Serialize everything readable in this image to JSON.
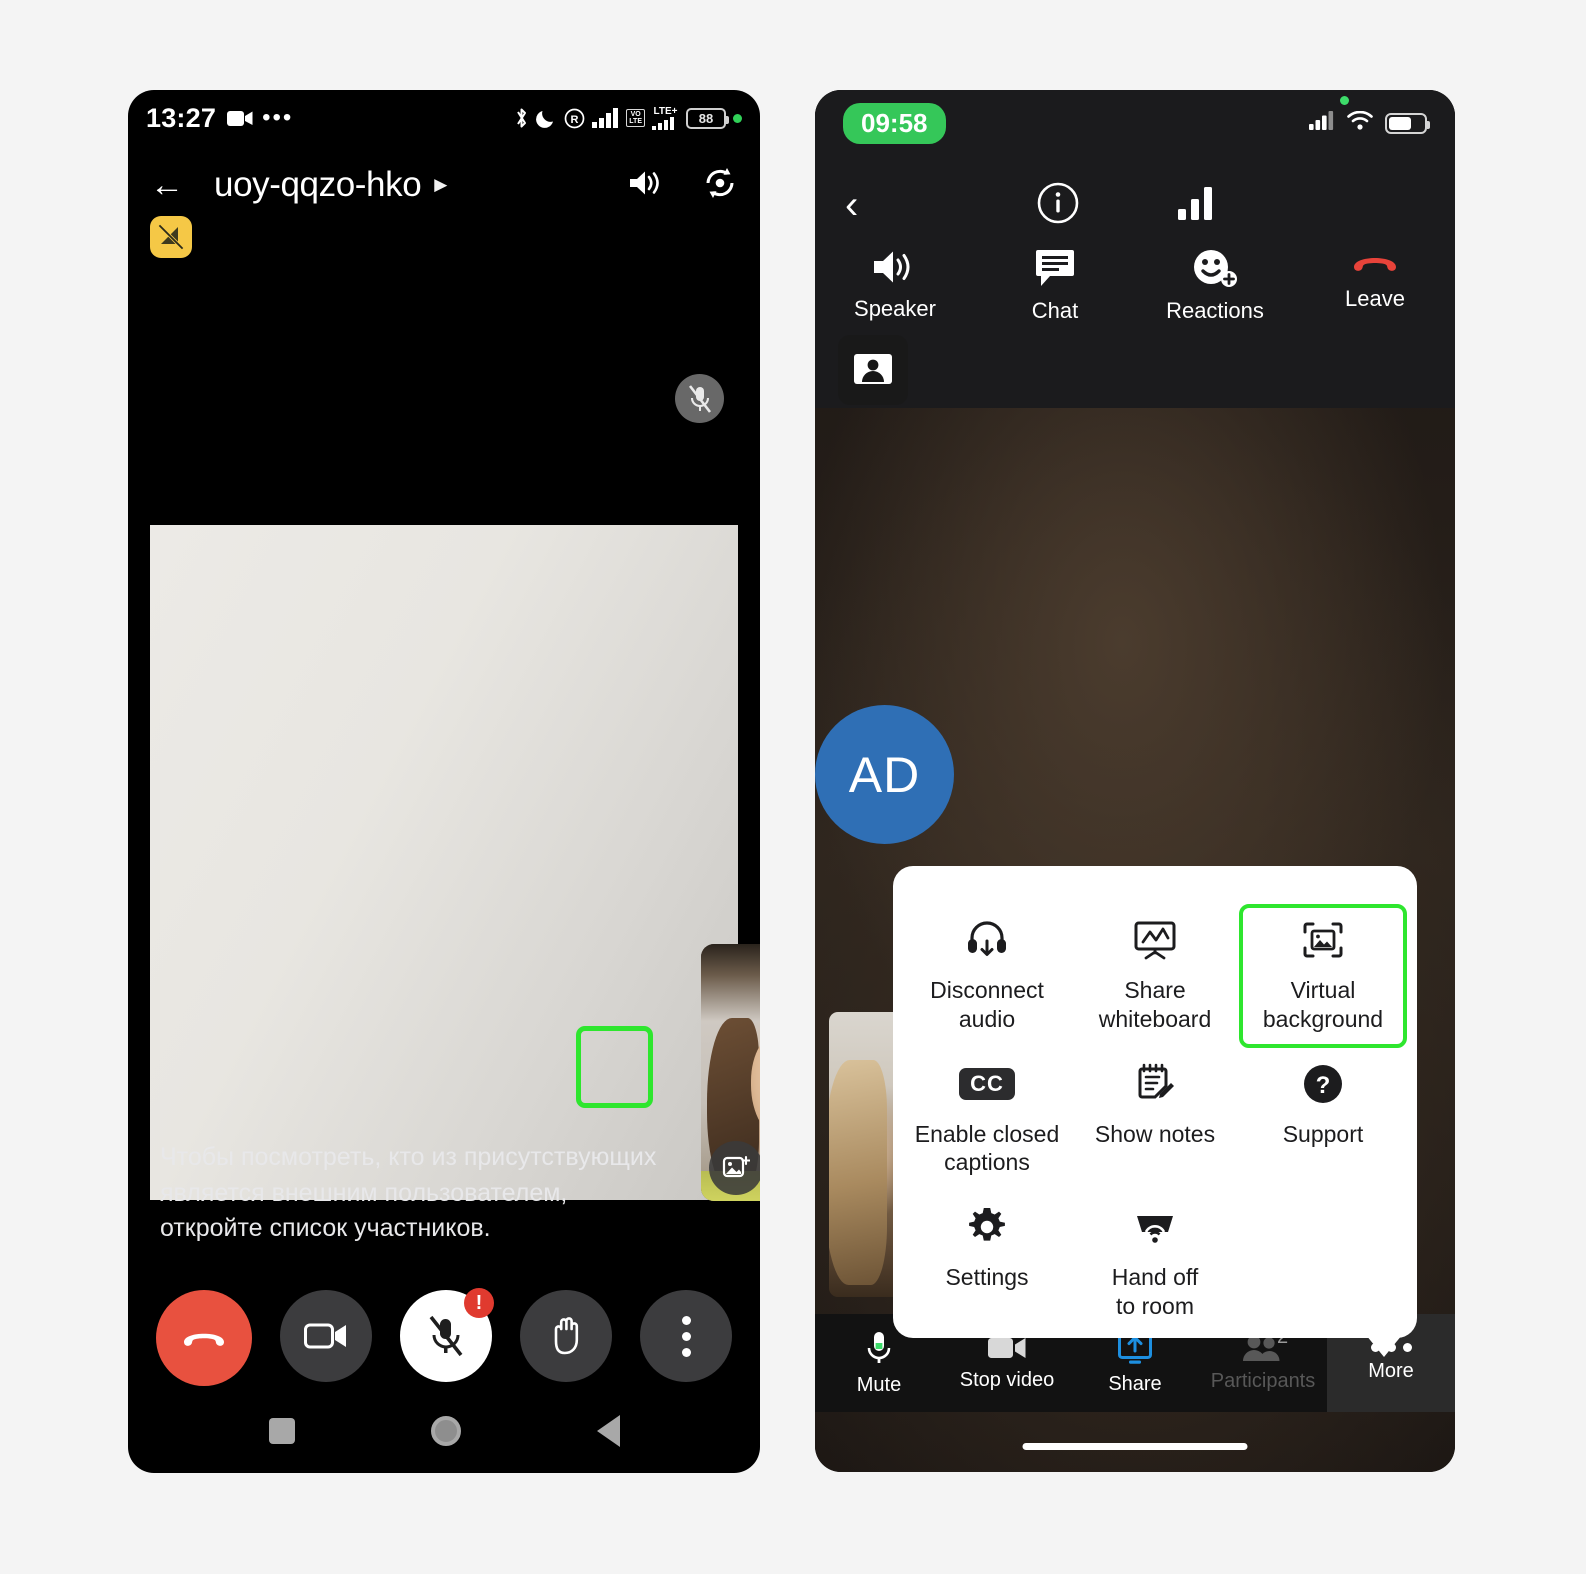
{
  "android": {
    "status_bar": {
      "time": "13:27",
      "battery_level": "88",
      "icons": [
        "camera-icon",
        "more-dots-icon",
        "bluetooth-icon",
        "dnd-moon-icon",
        "roaming-r-icon",
        "signal-bars-icon",
        "volte-icon",
        "lte-plus-icon",
        "battery-icon",
        "green-dot-icon"
      ],
      "volte_label": "VO\nLTE",
      "lte_label": "LTE+"
    },
    "header": {
      "meeting_code": "uoy-qqzo-hko",
      "back_icon": "back-arrow-icon",
      "caret_icon": "chevron-right-icon",
      "speaker_icon": "speaker-icon",
      "flip_camera_icon": "flip-camera-icon"
    },
    "network_badge_icon": "network-off-icon",
    "stage": {
      "mic_muted_icon": "mic-off-icon"
    },
    "pip": {
      "effects_icon": "image-effects-icon",
      "more_icon": "more-vertical-icon",
      "highlighted": "effects-button"
    },
    "caption": "Чтобы посмотреть, кто из присутствующих является внешним пользователем, откройте список участников.",
    "controls": [
      {
        "name": "end-call-button",
        "icon": "phone-hangup-icon",
        "style": "end"
      },
      {
        "name": "camera-button",
        "icon": "video-camera-icon",
        "style": "dark"
      },
      {
        "name": "mic-button",
        "icon": "mic-off-icon",
        "style": "white",
        "badge": "!"
      },
      {
        "name": "raise-hand-button",
        "icon": "raised-hand-icon",
        "style": "dark"
      },
      {
        "name": "more-button",
        "icon": "more-vertical-icon",
        "style": "dark"
      }
    ],
    "nav_bar": [
      "recents-square-icon",
      "home-circle-icon",
      "back-triangle-icon"
    ]
  },
  "ios": {
    "status_bar": {
      "time": "09:58",
      "time_pill_color": "#35c759",
      "icons": [
        "recording-dot-icon",
        "cellular-signal-icon",
        "wifi-icon",
        "battery-icon"
      ]
    },
    "top_row": {
      "back_icon": "back-chevron-icon",
      "info_icon": "info-circle-icon",
      "stats_icon": "signal-bars-icon"
    },
    "actions": [
      {
        "label": "Speaker",
        "icon": "speaker-icon"
      },
      {
        "label": "Chat",
        "icon": "chat-bubble-icon"
      },
      {
        "label": "Reactions",
        "icon": "reactions-smiley-icon"
      },
      {
        "label": "Leave",
        "icon": "phone-hangup-icon",
        "color": "#e8433a"
      }
    ],
    "person_card_icon": "contact-card-icon",
    "avatar": {
      "initials": "AD",
      "color": "#2f6fb5"
    },
    "popup": {
      "highlighted_item": "Virtual background",
      "highlight_color": "#2ee62e",
      "items": [
        {
          "label": "Disconnect\naudio",
          "icon": "headset-disconnect-icon",
          "highlight": false
        },
        {
          "label": "Share\nwhiteboard",
          "icon": "whiteboard-icon",
          "highlight": false
        },
        {
          "label": "Virtual\nbackground",
          "icon": "virtual-background-icon",
          "highlight": true
        },
        {
          "label": "Enable closed\ncaptions",
          "icon": "closed-captions-icon",
          "highlight": false
        },
        {
          "label": "Show notes",
          "icon": "notes-edit-icon",
          "highlight": false
        },
        {
          "label": "Support",
          "icon": "question-circle-icon",
          "highlight": false
        },
        {
          "label": "Settings",
          "icon": "gear-icon",
          "highlight": false
        },
        {
          "label": "Hand off\nto room",
          "icon": "hand-off-room-icon",
          "highlight": false
        }
      ]
    },
    "bottom_bar": [
      {
        "label": "Mute",
        "icon": "microphone-icon",
        "state": "normal"
      },
      {
        "label": "Stop video",
        "icon": "video-camera-icon",
        "state": "normal"
      },
      {
        "label": "Share",
        "icon": "share-screen-icon",
        "state": "accent",
        "accent_color": "#1d8fe0"
      },
      {
        "label": "Participants",
        "icon": "participants-icon",
        "state": "dim",
        "badge": "2"
      },
      {
        "label": "More",
        "icon": "more-horizontal-icon",
        "state": "active"
      }
    ]
  }
}
